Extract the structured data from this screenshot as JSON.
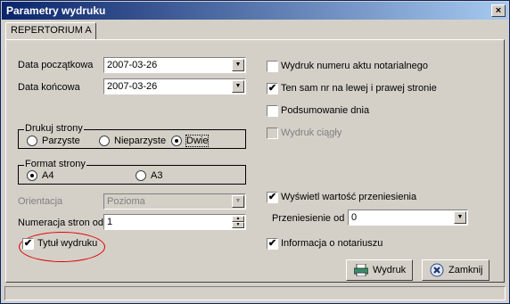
{
  "window": {
    "title": "Parametry wydruku",
    "close_symbol": "×"
  },
  "tabs": [
    {
      "label": "REPERTORIUM A"
    }
  ],
  "left": {
    "start_date": {
      "label": "Data początkowa",
      "value": "2007-03-26"
    },
    "end_date": {
      "label": "Data końcowa",
      "value": "2007-03-26"
    },
    "print_pages": {
      "legend": "Drukuj strony",
      "options": [
        "Parzyste",
        "Nieparzyste",
        "Dwie"
      ],
      "selected": "Dwie"
    },
    "page_format": {
      "legend": "Format strony",
      "options": [
        "A4",
        "A3"
      ],
      "selected": "A4"
    },
    "orientation": {
      "label": "Orientacja",
      "value": "Pozioma",
      "enabled": false
    },
    "numbering": {
      "label": "Numeracja stron od",
      "value": "1"
    },
    "print_title": {
      "label": "Tytuł wydruku",
      "checked": true
    }
  },
  "right": {
    "checkboxes": [
      {
        "label": "Wydruk numeru aktu notarialnego",
        "checked": false,
        "enabled": true
      },
      {
        "label": "Ten sam nr na lewej i prawej stronie",
        "checked": true,
        "enabled": true
      },
      {
        "label": "Podsumowanie dnia",
        "checked": false,
        "enabled": true
      },
      {
        "label": "Wydruk ciągły",
        "checked": false,
        "enabled": false
      }
    ],
    "show_transfer": {
      "label": "Wyświetl wartość przeniesienia",
      "checked": true
    },
    "transfer_from": {
      "label": "Przeniesienie od",
      "value": "0"
    },
    "notary_info": {
      "label": "Informacja o notariuszu",
      "checked": true
    }
  },
  "buttons": {
    "print": {
      "label": "Wydruk",
      "icon": "printer-icon"
    },
    "close": {
      "label": "Zamknij",
      "icon": "close-x-icon"
    }
  },
  "annotation": {
    "color": "#e00000",
    "shape": "ellipse"
  },
  "check_symbol": "✔"
}
